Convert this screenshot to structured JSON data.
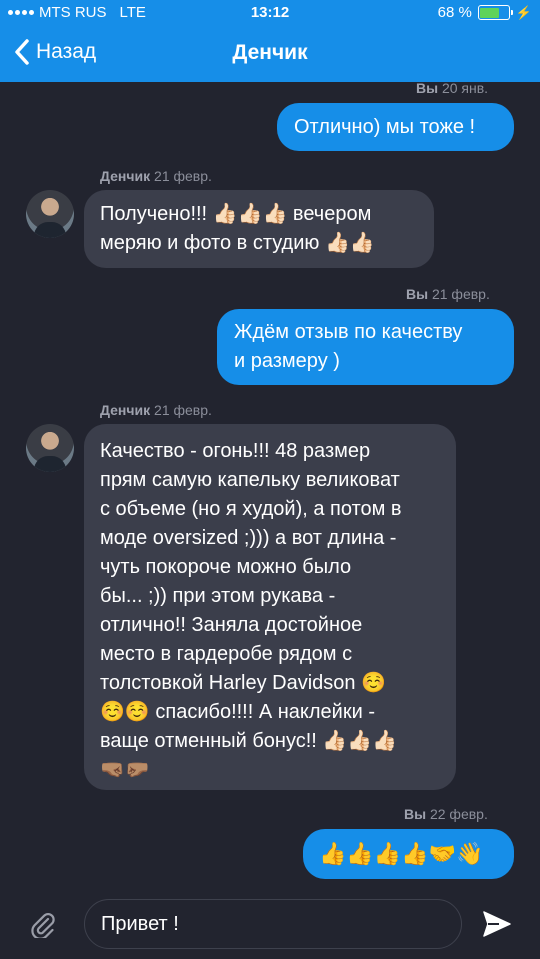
{
  "status": {
    "carrier": "MTS RUS",
    "network": "LTE",
    "time": "13:12",
    "battery": "68 %",
    "battery_level": 0.68
  },
  "nav": {
    "back_label": "Назад",
    "title": "Денчик"
  },
  "messages": [
    {
      "meta_sender": "Вы",
      "meta_date": "20 янв."
    },
    {
      "lines": [
        "Отлично) мы тоже !"
      ]
    },
    {
      "meta_sender": "Денчик",
      "meta_date": "21 февр."
    },
    {
      "lines": [
        "Получено!!! 👍🏻👍🏻👍🏻 вечером",
        "меряю и фото в студию 👍🏻👍🏻"
      ]
    },
    {
      "meta_sender": "Вы",
      "meta_date": "21 февр."
    },
    {
      "lines": [
        "Ждём отзыв по качеству",
        "и размеру )"
      ]
    },
    {
      "meta_sender": "Денчик",
      "meta_date": "21 февр."
    },
    {
      "lines": [
        "Качество - огонь!!! 48 размер",
        "прям самую капельку великоват",
        "с объеме (но я худой), а потом в",
        "моде oversized ;))) а вот длина -",
        "чуть покороче можно было",
        "бы... ;)) при этом рукава -",
        "отлично!! Заняла достойное",
        "место в гардеробе рядом с",
        "толстовкой Harley Davidson ☺️",
        "☺️☺️ спасибо!!!! А наклейки -",
        "ваще отменный бонус!! 👍🏻👍🏻👍🏻",
        "🤜🏽🤛🏽"
      ]
    },
    {
      "meta_sender": "Вы",
      "meta_date": "22 февр."
    },
    {
      "lines": [
        "👍👍👍👍🤝👋"
      ]
    }
  ],
  "composer": {
    "text": "Привет !"
  }
}
